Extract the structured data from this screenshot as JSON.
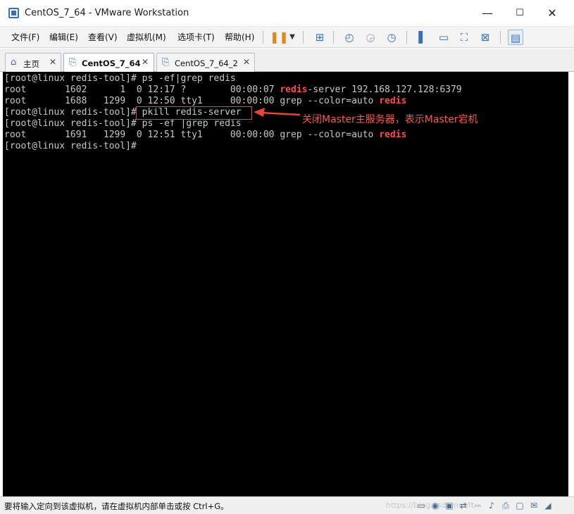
{
  "window": {
    "title": "CentOS_7_64 - VMware Workstation",
    "minimize": "—",
    "maximize": "☐",
    "close": "✕"
  },
  "menu": {
    "items": [
      "文件(F)",
      "编辑(E)",
      "查看(V)",
      "虚拟机(M)",
      "选项卡(T)",
      "帮助(H)"
    ]
  },
  "tabs": [
    {
      "label": "主页",
      "active": false
    },
    {
      "label": "CentOS_7_64",
      "active": true
    },
    {
      "label": "CentOS_7_64_2",
      "active": false
    }
  ],
  "terminal": {
    "lines": [
      [
        {
          "t": "[root@linux redis-tool]# ps -ef|grep redis"
        }
      ],
      [
        {
          "t": "root       1602      1  0 12:17 ?        00:00:07 "
        },
        {
          "t": "redis",
          "red": true
        },
        {
          "t": "-server 192.168.127.128:6379"
        }
      ],
      [
        {
          "t": "root       1688   1299  0 12:50 tty1     00:00:00 grep --color=auto "
        },
        {
          "t": "redis",
          "red": true
        }
      ],
      [
        {
          "t": "[root@linux redis-tool]# pkill redis-server"
        }
      ],
      [
        {
          "t": "[root@linux redis-tool]# ps -ef |grep redis"
        }
      ],
      [
        {
          "t": "root       1691   1299  0 12:51 tty1     00:00:00 grep --color=auto "
        },
        {
          "t": "redis",
          "red": true
        }
      ],
      [
        {
          "t": "[root@linux redis-tool]#"
        }
      ]
    ],
    "annotation": "关闭Master主服务器，表示Master宕机"
  },
  "status": {
    "message": "要将输入定向到该虚拟机，请在虚拟机内部单击或按 Ctrl+G。",
    "watermark": "https://blog.csdn.net/lt"
  },
  "colors": {
    "terminal_bg": "#000000",
    "terminal_fg": "#c8c8c8",
    "highlight_red": "#ff4a4a",
    "annotation_red": "#ff5a4a"
  }
}
